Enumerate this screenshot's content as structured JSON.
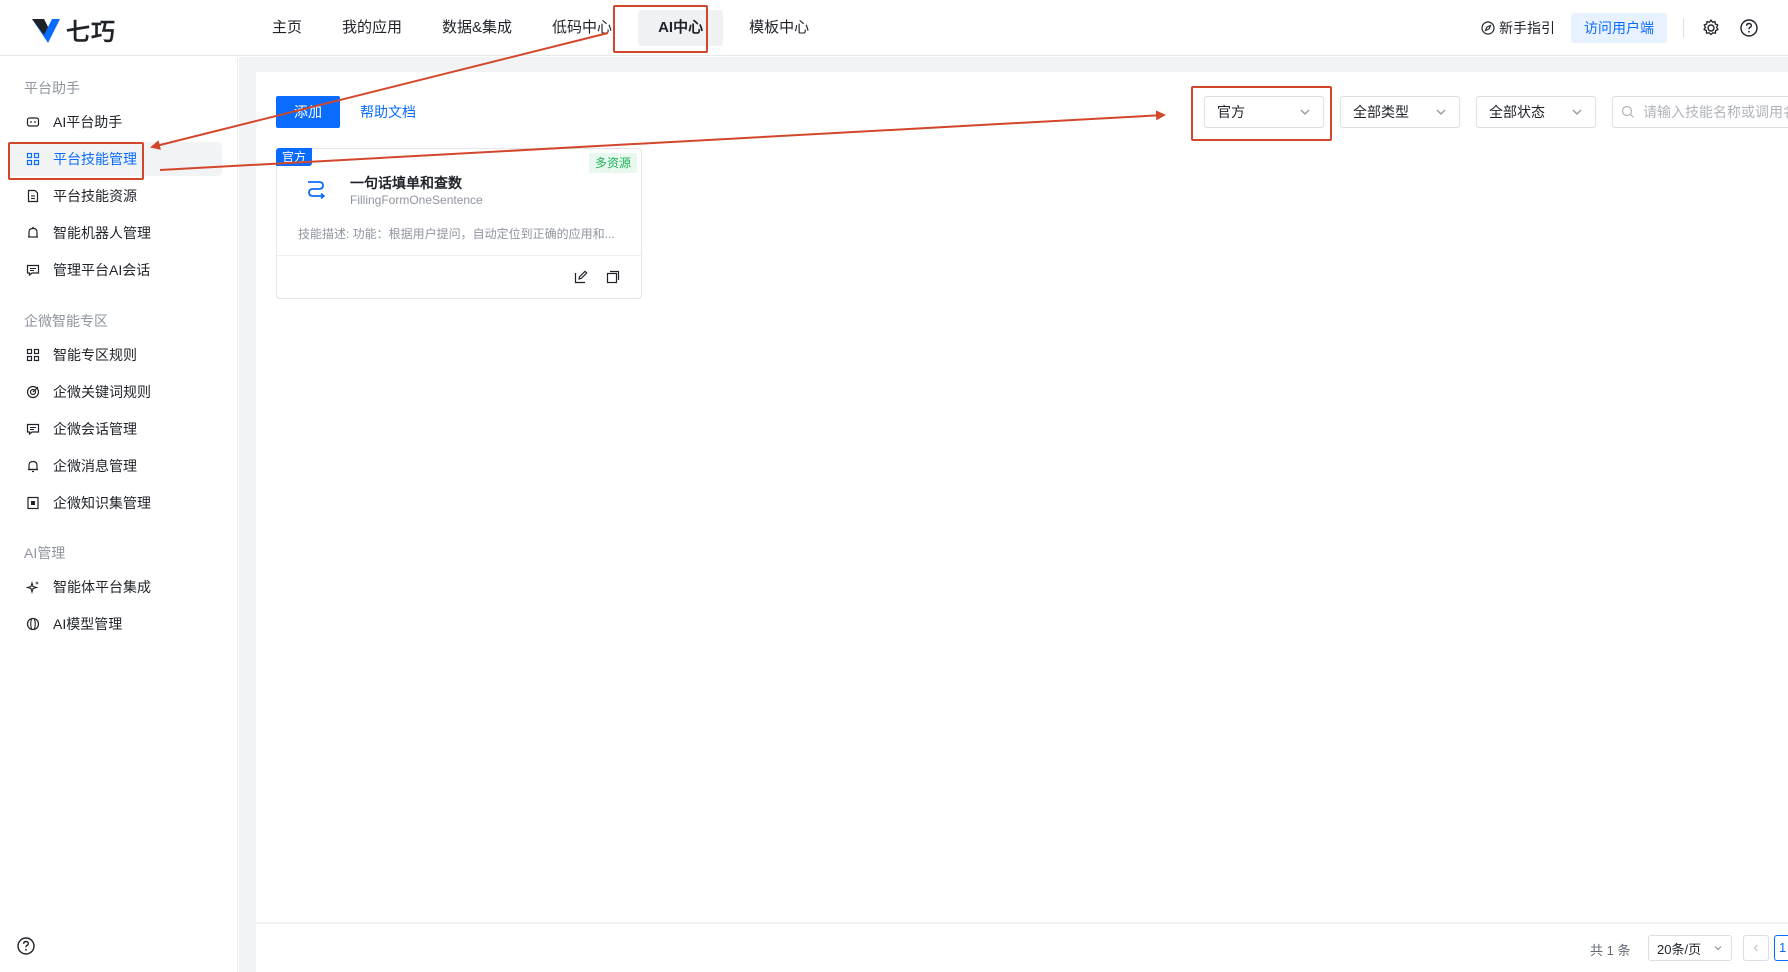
{
  "brand": {
    "name": "七巧",
    "logo_color": "#0a6cff"
  },
  "nav": {
    "items": [
      {
        "label": "主页"
      },
      {
        "label": "我的应用"
      },
      {
        "label": "数据&集成"
      },
      {
        "label": "低码中心"
      },
      {
        "label": "AI中心",
        "active": true
      },
      {
        "label": "模板中心"
      }
    ]
  },
  "topright": {
    "guide_label": "新手指引",
    "visit_label": "访问用户端",
    "icons": [
      "compass-icon",
      "gear-icon",
      "help-icon"
    ]
  },
  "sidebar": {
    "groups": [
      {
        "title": "平台助手",
        "items": [
          {
            "label": "AI平台助手",
            "icon": "bot-icon"
          },
          {
            "label": "平台技能管理",
            "icon": "grid-icon",
            "active": true
          },
          {
            "label": "平台技能资源",
            "icon": "file-icon"
          },
          {
            "label": "智能机器人管理",
            "icon": "robot-icon"
          },
          {
            "label": "管理平台AI会话",
            "icon": "chat-icon"
          }
        ]
      },
      {
        "title": "企微智能专区",
        "items": [
          {
            "label": "智能专区规则",
            "icon": "grid-icon"
          },
          {
            "label": "企微关键词规则",
            "icon": "target-icon"
          },
          {
            "label": "企微会话管理",
            "icon": "chat-icon"
          },
          {
            "label": "企微消息管理",
            "icon": "bell-icon"
          },
          {
            "label": "企微知识集管理",
            "icon": "book-icon"
          }
        ]
      },
      {
        "title": "AI管理",
        "items": [
          {
            "label": "智能体平台集成",
            "icon": "sparkle-icon"
          },
          {
            "label": "AI模型管理",
            "icon": "model-icon"
          }
        ]
      }
    ]
  },
  "toolbar": {
    "add_label": "添加",
    "help_label": "帮助文档",
    "filter_source": "官方",
    "filter_type": "全部类型",
    "filter_status": "全部状态",
    "search_placeholder": "请输入技能名称或调用名"
  },
  "card": {
    "badge_official": "官方",
    "badge_resource": "多资源",
    "title": "一句话填单和查数",
    "subtitle": "FillingFormOneSentence",
    "description": "技能描述: 功能：根据用户提问，自动定位到正确的应用和..."
  },
  "pagination": {
    "total": "共 1 条",
    "page_size": "20条/页",
    "current_page": "1"
  },
  "colors": {
    "primary": "#0a6cff",
    "annotation": "#d2472b",
    "success": "#21b35a"
  }
}
